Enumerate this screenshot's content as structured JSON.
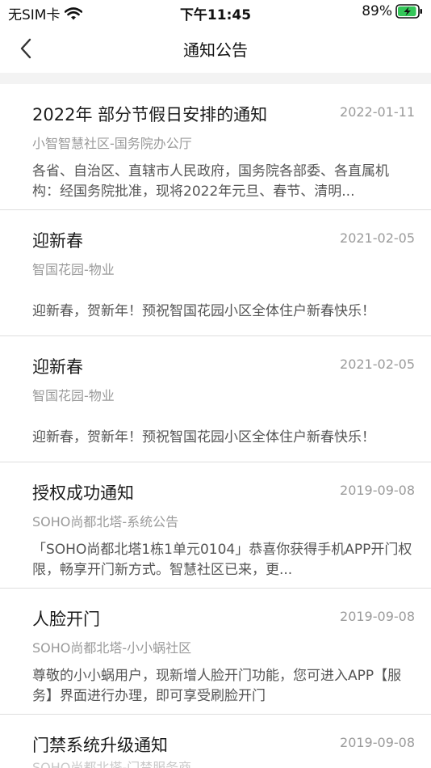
{
  "status_bar": {
    "carrier": "无SIM卡",
    "time": "下午11:45",
    "battery_percent": "89%"
  },
  "nav": {
    "title": "通知公告"
  },
  "notices": [
    {
      "title": "2022年  部分节假日安排的通知",
      "date": "2022-01-11",
      "source": "小智智慧社区-国务院办公厅",
      "body": "各省、自治区、直辖市人民政府，国务院各部委、各直属机构：经国务院批准，现将2022年元旦、春节、清明..."
    },
    {
      "title": "迎新春",
      "date": "2021-02-05",
      "source": "智国花园-物业",
      "body": "迎新春，贺新年！预祝智国花园小区全体住户新春快乐！"
    },
    {
      "title": "迎新春",
      "date": "2021-02-05",
      "source": "智国花园-物业",
      "body": "迎新春，贺新年！预祝智国花园小区全体住户新春快乐！"
    },
    {
      "title": "授权成功通知",
      "date": "2019-09-08",
      "source": "SOHO尚都北塔-系统公告",
      "body": "「SOHO尚都北塔1栋1单元0104」恭喜你获得手机APP开门权限，畅享开门新方式。智慧社区已来，更..."
    },
    {
      "title": "人脸开门",
      "date": "2019-09-08",
      "source": "SOHO尚都北塔-小小蜗社区",
      "body": "尊敬的小小蜗用户，现新增人脸开门功能，您可进入APP【服务】界面进行办理，即可享受刷脸开门"
    },
    {
      "title": "门禁系统升级通知",
      "date": "2019-09-08",
      "source": "SOHO尚都北塔-门禁服务商"
    }
  ]
}
